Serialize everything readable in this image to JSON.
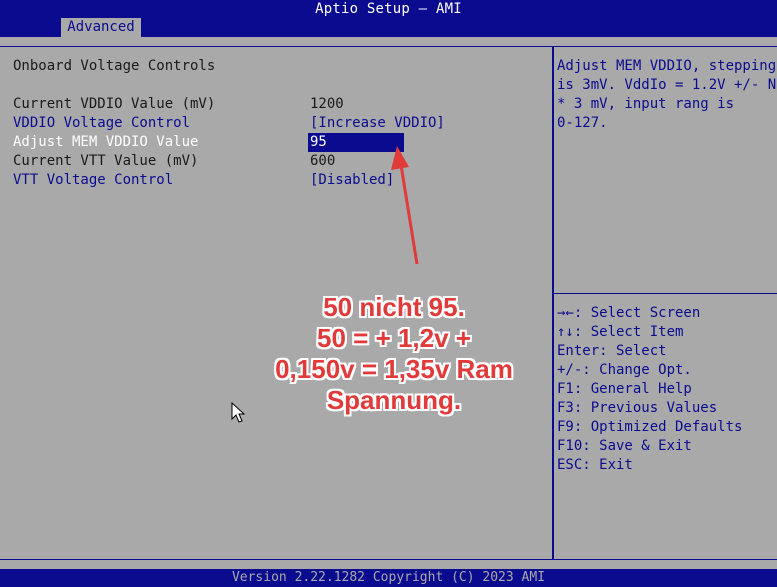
{
  "header": {
    "title": "Aptio Setup – AMI",
    "tabs": [
      {
        "label": "Advanced",
        "active": true
      }
    ]
  },
  "main": {
    "section_title": "Onboard Voltage Controls",
    "rows": [
      {
        "label": "Current VDDIO Value (mV)",
        "value": "1200"
      },
      {
        "label": "VDDIO Voltage Control",
        "value": "[Increase VDDIO]"
      },
      {
        "label": "Adjust MEM VDDIO Value",
        "value": "95"
      },
      {
        "label": "Current VTT Value (mV)",
        "value": "600"
      },
      {
        "label": "VTT Voltage Control",
        "value": "[Disabled]"
      }
    ]
  },
  "help": {
    "text": "Adjust MEM VDDIO, stepping\nis 3mV. VddIo = 1.2V +/- N\n* 3 mV, input rang is\n0-127."
  },
  "keys": [
    "→←: Select Screen",
    "↑↓: Select Item",
    "Enter: Select",
    "+/-: Change Opt.",
    "F1: General Help",
    "F3: Previous Values",
    "F9: Optimized Defaults",
    "F10: Save & Exit",
    "ESC: Exit"
  ],
  "footer": {
    "text": "Version 2.22.1282 Copyright (C) 2023 AMI"
  },
  "annotation": {
    "lines": [
      "50 nicht 95.",
      "50 = + 1,2v +",
      "0,150v = 1,35v Ram",
      "Spannung."
    ],
    "color": "#e03a3a"
  },
  "colors": {
    "bios_blue": "#0b0b8f",
    "bios_gray": "#a9a9a9",
    "annotation_red": "#e03a3a"
  }
}
